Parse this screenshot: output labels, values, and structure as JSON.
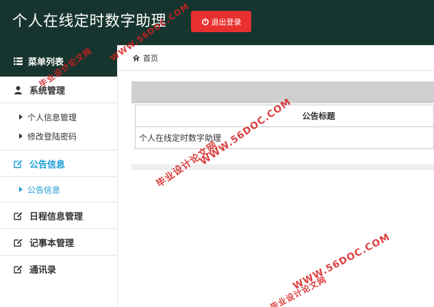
{
  "header": {
    "title": "个人在线定时数字助理",
    "logout_label": "退出登录",
    "background": "#16352e",
    "logout_color": "#e8312f"
  },
  "sidebar": {
    "menu_title": "菜单列表",
    "sections": [
      {
        "label": "系统管理",
        "icon": "user-icon",
        "subitems": [
          "个人信息管理",
          "修改登陆密码"
        ]
      },
      {
        "label": "公告信息",
        "icon": "edit-icon",
        "active": true,
        "subitems": [
          "公告信息"
        ]
      },
      {
        "label": "日程信息管理",
        "icon": "edit-icon"
      },
      {
        "label": "记事本管理",
        "icon": "edit-icon"
      },
      {
        "label": "通讯录",
        "icon": "edit-icon"
      }
    ],
    "active_color": "#1a9bd4"
  },
  "breadcrumb": {
    "home_icon": "home-icon",
    "label": "首页"
  },
  "table": {
    "columns": [
      "公告标题"
    ],
    "rows": [
      [
        "个人在线定时数字助理"
      ]
    ]
  },
  "watermark": {
    "site": "WWW.56DOC.COM",
    "tagline": "毕业设计论文网",
    "color": "#d71e1e"
  }
}
